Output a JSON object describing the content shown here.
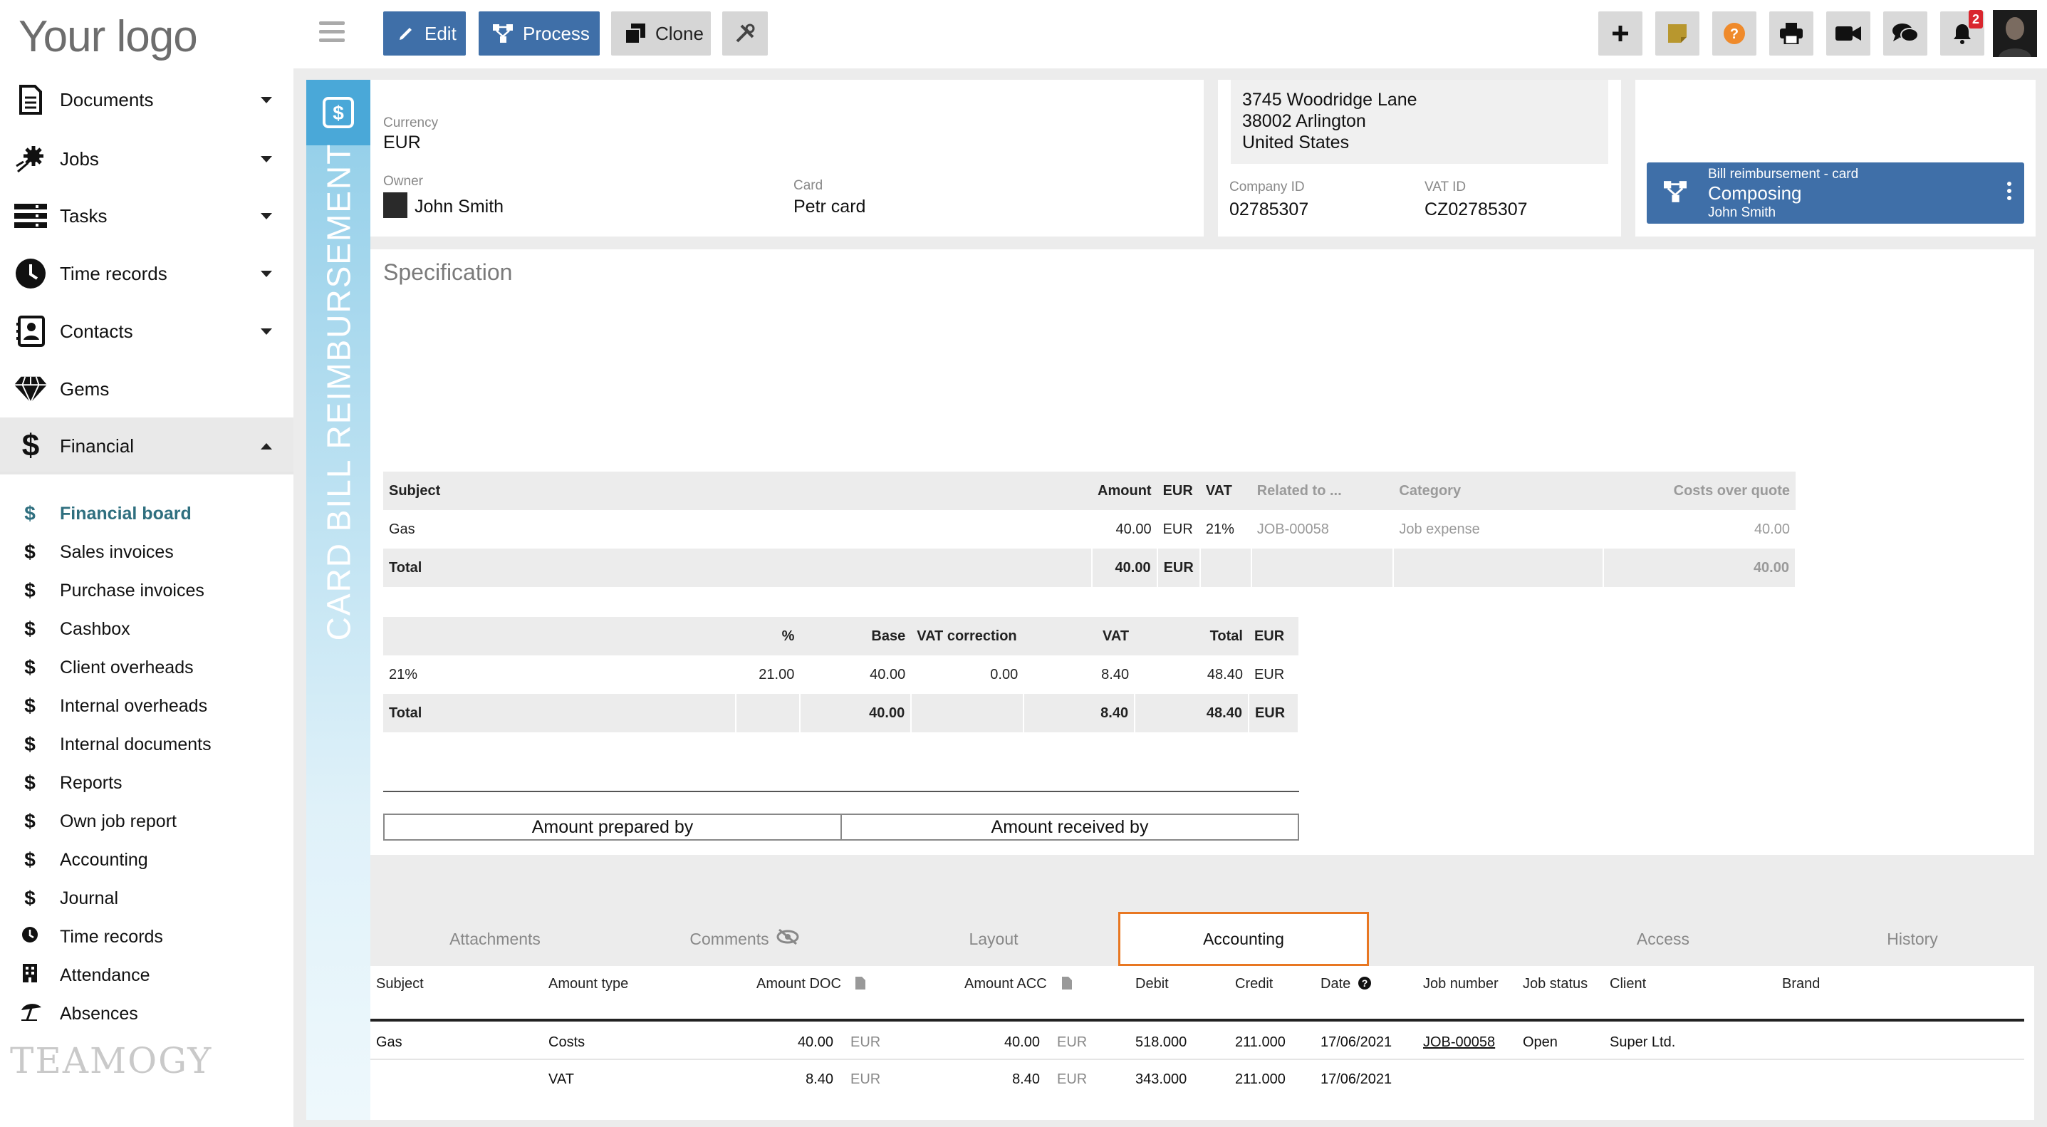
{
  "logo_text": "Your logo",
  "brand_footer": "TEAMOGY",
  "sidebar": {
    "items": [
      {
        "label": "Documents",
        "icon": "document-icon"
      },
      {
        "label": "Jobs",
        "icon": "jobs-icon"
      },
      {
        "label": "Tasks",
        "icon": "tasks-icon"
      },
      {
        "label": "Time records",
        "icon": "clock-icon"
      },
      {
        "label": "Contacts",
        "icon": "contacts-icon"
      },
      {
        "label": "Gems",
        "icon": "gem-icon"
      },
      {
        "label": "Financial",
        "icon": "dollar-icon"
      }
    ],
    "submenu": [
      {
        "label": "Financial board"
      },
      {
        "label": "Sales invoices"
      },
      {
        "label": "Purchase invoices"
      },
      {
        "label": "Cashbox"
      },
      {
        "label": "Client overheads"
      },
      {
        "label": "Internal overheads"
      },
      {
        "label": "Internal documents"
      },
      {
        "label": "Reports"
      },
      {
        "label": "Own job report"
      },
      {
        "label": "Accounting"
      },
      {
        "label": "Journal"
      },
      {
        "label": "Time records"
      },
      {
        "label": "Attendance"
      },
      {
        "label": "Absences"
      }
    ]
  },
  "toolbar": {
    "edit": "Edit",
    "process": "Process",
    "clone": "Clone",
    "notifications_count": "2"
  },
  "doc_type": "CARD BILL REIMBURSEMENT",
  "header": {
    "currency_label": "Currency",
    "currency_value": "EUR",
    "owner_label": "Owner",
    "owner_value": "John Smith",
    "card_label": "Card",
    "card_value": "Petr card",
    "address": [
      "3745 Woodridge Lane",
      "38002 Arlington",
      "United States"
    ],
    "company_id_label": "Company ID",
    "company_id_value": "02785307",
    "vat_id_label": "VAT ID",
    "vat_id_value": "CZ02785307"
  },
  "workflow": {
    "name": "Bill reimbursement - card",
    "state": "Composing",
    "user": "John Smith"
  },
  "specification": {
    "title": "Specification",
    "items_table": {
      "headers": [
        "Subject",
        "Amount",
        "EUR",
        "VAT",
        "Related to ...",
        "Category",
        "Costs over quote"
      ],
      "row": [
        "Gas",
        "40.00",
        "EUR",
        "21%",
        "JOB-00058",
        "Job expense",
        "40.00"
      ],
      "total": [
        "Total",
        "40.00",
        "EUR",
        "",
        "",
        "40.00"
      ]
    },
    "vat_table": {
      "headers": [
        "",
        "%",
        "Base",
        "VAT correction",
        "VAT",
        "Total",
        "EUR"
      ],
      "row": [
        "21%",
        "21.00",
        "40.00",
        "0.00",
        "8.40",
        "48.40",
        "EUR"
      ],
      "total": [
        "Total",
        "",
        "40.00",
        "",
        "8.40",
        "48.40",
        "EUR"
      ]
    },
    "prepared_by": "Amount prepared by",
    "received_by": "Amount received by"
  },
  "tabs": [
    "Attachments",
    "Comments",
    "Layout",
    "Accounting",
    "Access",
    "History"
  ],
  "accounting": {
    "headers": [
      "Subject",
      "Amount type",
      "Amount DOC",
      "Amount ACC",
      "Debit",
      "Credit",
      "Date",
      "Job number",
      "Job status",
      "Client",
      "Brand"
    ],
    "rows": [
      {
        "subject": "Gas",
        "type": "Costs",
        "amount_doc": "40.00",
        "cur_doc": "EUR",
        "amount_acc": "40.00",
        "cur_acc": "EUR",
        "debit": "518.000",
        "credit": "211.000",
        "date": "17/06/2021",
        "job": "JOB-00058",
        "status": "Open",
        "client": "Super Ltd."
      },
      {
        "subject": "",
        "type": "VAT",
        "amount_doc": "8.40",
        "cur_doc": "EUR",
        "amount_acc": "8.40",
        "cur_acc": "EUR",
        "debit": "343.000",
        "credit": "211.000",
        "date": "17/06/2021",
        "job": "",
        "status": "",
        "client": ""
      }
    ]
  },
  "colors": {
    "accent_blue": "#3f6fa8",
    "strip_blue": "#4aa8d8",
    "tab_highlight": "#e87722",
    "badge_red": "#d9262e"
  }
}
